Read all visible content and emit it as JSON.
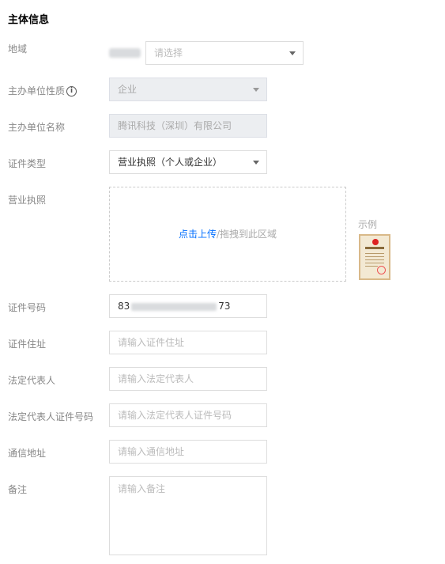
{
  "section_title": "主体信息",
  "region": {
    "label": "地域",
    "placeholder": "请选择"
  },
  "org_type": {
    "label": "主办单位性质",
    "info_icon": "info-circle-icon",
    "value": "企业"
  },
  "org_name": {
    "label": "主办单位名称",
    "value": "腾讯科技（深圳）有限公司"
  },
  "cert_type": {
    "label": "证件类型",
    "value": "营业执照（个人或企业）"
  },
  "license": {
    "label": "营业执照",
    "upload_link": "点击上传",
    "upload_hint": "/拖拽到此区域",
    "example_label": "示例"
  },
  "cert_number": {
    "label": "证件号码",
    "prefix": "83",
    "suffix": "73"
  },
  "cert_address": {
    "label": "证件住址",
    "placeholder": "请输入证件住址"
  },
  "legal_rep": {
    "label": "法定代表人",
    "placeholder": "请输入法定代表人"
  },
  "legal_rep_id": {
    "label": "法定代表人证件号码",
    "placeholder": "请输入法定代表人证件号码"
  },
  "mail_address": {
    "label": "通信地址",
    "placeholder": "请输入通信地址"
  },
  "remark": {
    "label": "备注",
    "placeholder": "请输入备注"
  },
  "colors": {
    "link": "#006eff",
    "disabled_bg": "#eceef1",
    "border": "#dddddd"
  }
}
